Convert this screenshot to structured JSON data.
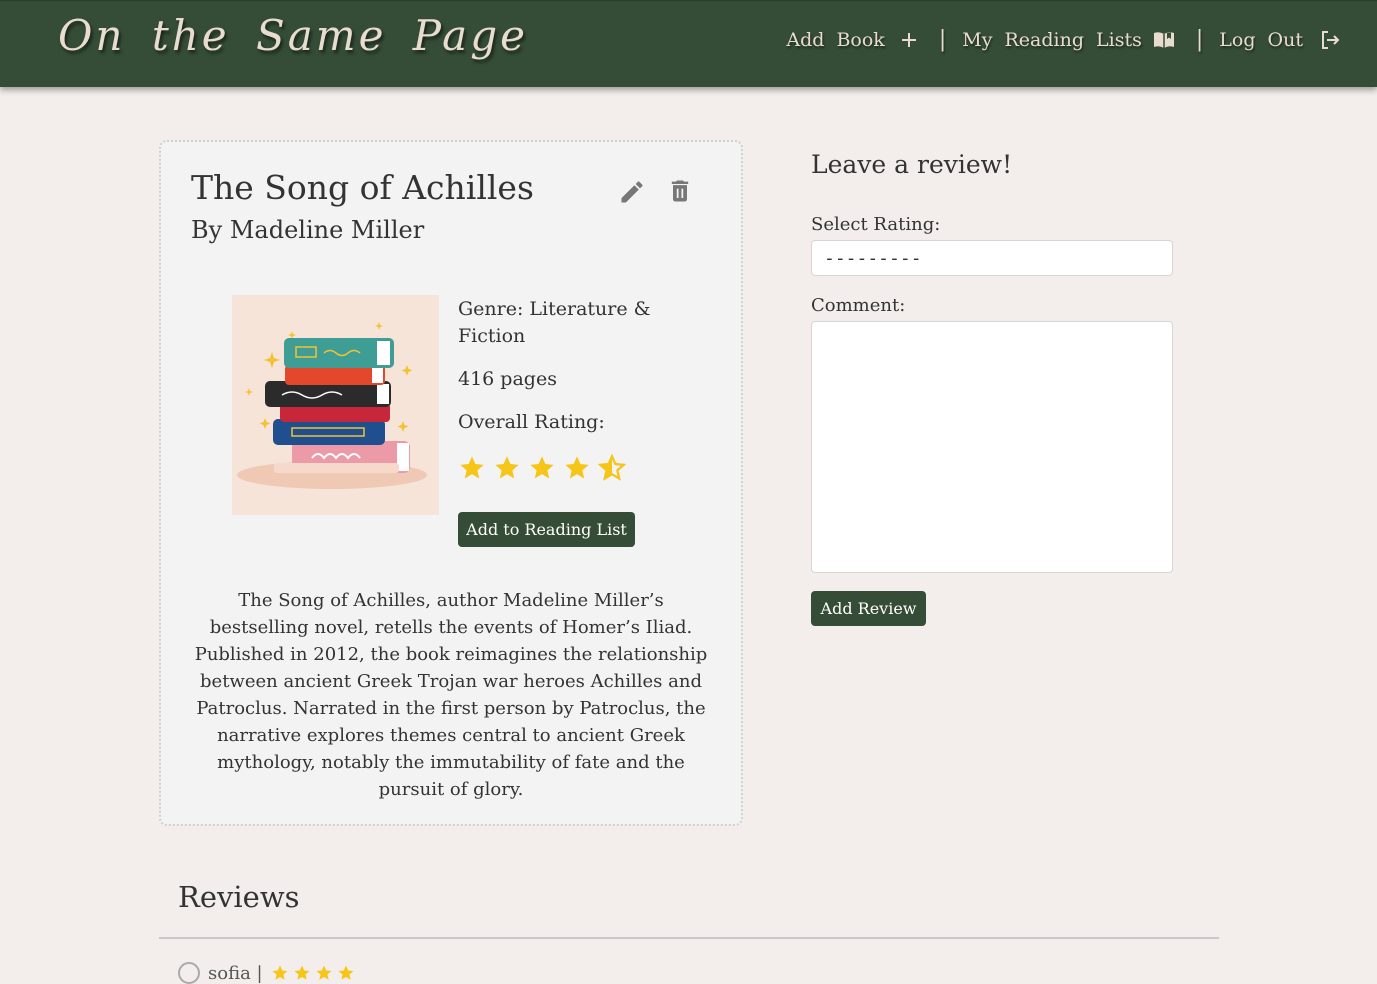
{
  "app": {
    "brand": "On the Same Page"
  },
  "nav": {
    "add_book": "Add Book",
    "reading_lists": "My Reading Lists",
    "logout": "Log Out"
  },
  "book": {
    "title": "The Song of Achilles",
    "author": "By Madeline Miller",
    "genre": "Genre: Literature & Fiction",
    "pages": "416 pages",
    "rating_label": "Overall Rating:",
    "rating": 4.5,
    "rating_max": 5,
    "add_to_list_label": "Add to Reading List",
    "description": "The Song of Achilles, author Madeline Miller’s bestselling novel, retells the events of Homer’s Iliad. Published in 2012, the book reimagines the relationship between ancient Greek Trojan war heroes Achilles and Patroclus. Narrated in the first person by Patroclus, the narrative explores themes central to ancient Greek mythology, notably the immutability of fate and the pursuit of glory."
  },
  "review_form": {
    "title": "Leave a review!",
    "rating_label": "Select Rating:",
    "rating_value": "---------",
    "comment_label": "Comment:",
    "comment_value": "",
    "submit_label": "Add Review"
  },
  "reviews": {
    "title": "Reviews",
    "first_user": "sofia |"
  },
  "colors": {
    "nav_bg": "#354d37",
    "nav_text": "#e8dccf",
    "page_bg": "#f3eeeb",
    "button_bg": "#354d37",
    "star": "#f5c518"
  },
  "icons": [
    "plus-icon",
    "open-book-icon",
    "logout-icon",
    "pencil-icon",
    "trash-icon",
    "star-icon",
    "half-star-icon"
  ]
}
